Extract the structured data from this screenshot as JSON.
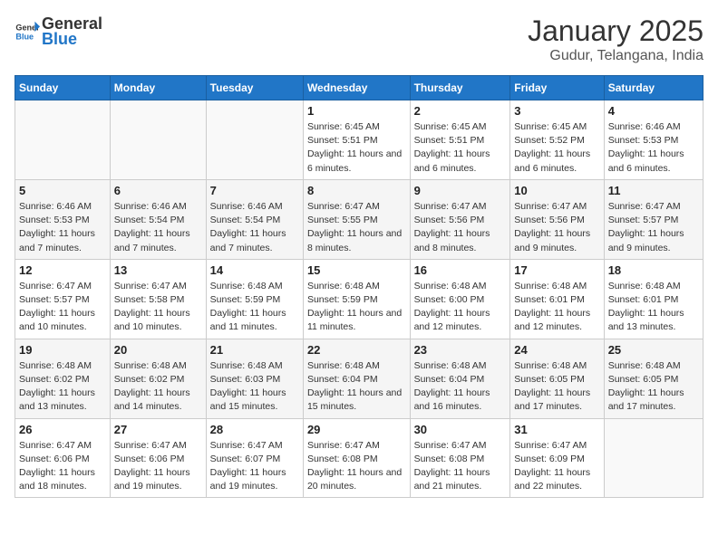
{
  "header": {
    "logo_general": "General",
    "logo_blue": "Blue",
    "title": "January 2025",
    "subtitle": "Gudur, Telangana, India"
  },
  "weekdays": [
    "Sunday",
    "Monday",
    "Tuesday",
    "Wednesday",
    "Thursday",
    "Friday",
    "Saturday"
  ],
  "weeks": [
    [
      {
        "day": "",
        "sunrise": "",
        "sunset": "",
        "daylight": ""
      },
      {
        "day": "",
        "sunrise": "",
        "sunset": "",
        "daylight": ""
      },
      {
        "day": "",
        "sunrise": "",
        "sunset": "",
        "daylight": ""
      },
      {
        "day": "1",
        "sunrise": "Sunrise: 6:45 AM",
        "sunset": "Sunset: 5:51 PM",
        "daylight": "Daylight: 11 hours and 6 minutes."
      },
      {
        "day": "2",
        "sunrise": "Sunrise: 6:45 AM",
        "sunset": "Sunset: 5:51 PM",
        "daylight": "Daylight: 11 hours and 6 minutes."
      },
      {
        "day": "3",
        "sunrise": "Sunrise: 6:45 AM",
        "sunset": "Sunset: 5:52 PM",
        "daylight": "Daylight: 11 hours and 6 minutes."
      },
      {
        "day": "4",
        "sunrise": "Sunrise: 6:46 AM",
        "sunset": "Sunset: 5:53 PM",
        "daylight": "Daylight: 11 hours and 6 minutes."
      }
    ],
    [
      {
        "day": "5",
        "sunrise": "Sunrise: 6:46 AM",
        "sunset": "Sunset: 5:53 PM",
        "daylight": "Daylight: 11 hours and 7 minutes."
      },
      {
        "day": "6",
        "sunrise": "Sunrise: 6:46 AM",
        "sunset": "Sunset: 5:54 PM",
        "daylight": "Daylight: 11 hours and 7 minutes."
      },
      {
        "day": "7",
        "sunrise": "Sunrise: 6:46 AM",
        "sunset": "Sunset: 5:54 PM",
        "daylight": "Daylight: 11 hours and 7 minutes."
      },
      {
        "day": "8",
        "sunrise": "Sunrise: 6:47 AM",
        "sunset": "Sunset: 5:55 PM",
        "daylight": "Daylight: 11 hours and 8 minutes."
      },
      {
        "day": "9",
        "sunrise": "Sunrise: 6:47 AM",
        "sunset": "Sunset: 5:56 PM",
        "daylight": "Daylight: 11 hours and 8 minutes."
      },
      {
        "day": "10",
        "sunrise": "Sunrise: 6:47 AM",
        "sunset": "Sunset: 5:56 PM",
        "daylight": "Daylight: 11 hours and 9 minutes."
      },
      {
        "day": "11",
        "sunrise": "Sunrise: 6:47 AM",
        "sunset": "Sunset: 5:57 PM",
        "daylight": "Daylight: 11 hours and 9 minutes."
      }
    ],
    [
      {
        "day": "12",
        "sunrise": "Sunrise: 6:47 AM",
        "sunset": "Sunset: 5:57 PM",
        "daylight": "Daylight: 11 hours and 10 minutes."
      },
      {
        "day": "13",
        "sunrise": "Sunrise: 6:47 AM",
        "sunset": "Sunset: 5:58 PM",
        "daylight": "Daylight: 11 hours and 10 minutes."
      },
      {
        "day": "14",
        "sunrise": "Sunrise: 6:48 AM",
        "sunset": "Sunset: 5:59 PM",
        "daylight": "Daylight: 11 hours and 11 minutes."
      },
      {
        "day": "15",
        "sunrise": "Sunrise: 6:48 AM",
        "sunset": "Sunset: 5:59 PM",
        "daylight": "Daylight: 11 hours and 11 minutes."
      },
      {
        "day": "16",
        "sunrise": "Sunrise: 6:48 AM",
        "sunset": "Sunset: 6:00 PM",
        "daylight": "Daylight: 11 hours and 12 minutes."
      },
      {
        "day": "17",
        "sunrise": "Sunrise: 6:48 AM",
        "sunset": "Sunset: 6:01 PM",
        "daylight": "Daylight: 11 hours and 12 minutes."
      },
      {
        "day": "18",
        "sunrise": "Sunrise: 6:48 AM",
        "sunset": "Sunset: 6:01 PM",
        "daylight": "Daylight: 11 hours and 13 minutes."
      }
    ],
    [
      {
        "day": "19",
        "sunrise": "Sunrise: 6:48 AM",
        "sunset": "Sunset: 6:02 PM",
        "daylight": "Daylight: 11 hours and 13 minutes."
      },
      {
        "day": "20",
        "sunrise": "Sunrise: 6:48 AM",
        "sunset": "Sunset: 6:02 PM",
        "daylight": "Daylight: 11 hours and 14 minutes."
      },
      {
        "day": "21",
        "sunrise": "Sunrise: 6:48 AM",
        "sunset": "Sunset: 6:03 PM",
        "daylight": "Daylight: 11 hours and 15 minutes."
      },
      {
        "day": "22",
        "sunrise": "Sunrise: 6:48 AM",
        "sunset": "Sunset: 6:04 PM",
        "daylight": "Daylight: 11 hours and 15 minutes."
      },
      {
        "day": "23",
        "sunrise": "Sunrise: 6:48 AM",
        "sunset": "Sunset: 6:04 PM",
        "daylight": "Daylight: 11 hours and 16 minutes."
      },
      {
        "day": "24",
        "sunrise": "Sunrise: 6:48 AM",
        "sunset": "Sunset: 6:05 PM",
        "daylight": "Daylight: 11 hours and 17 minutes."
      },
      {
        "day": "25",
        "sunrise": "Sunrise: 6:48 AM",
        "sunset": "Sunset: 6:05 PM",
        "daylight": "Daylight: 11 hours and 17 minutes."
      }
    ],
    [
      {
        "day": "26",
        "sunrise": "Sunrise: 6:47 AM",
        "sunset": "Sunset: 6:06 PM",
        "daylight": "Daylight: 11 hours and 18 minutes."
      },
      {
        "day": "27",
        "sunrise": "Sunrise: 6:47 AM",
        "sunset": "Sunset: 6:06 PM",
        "daylight": "Daylight: 11 hours and 19 minutes."
      },
      {
        "day": "28",
        "sunrise": "Sunrise: 6:47 AM",
        "sunset": "Sunset: 6:07 PM",
        "daylight": "Daylight: 11 hours and 19 minutes."
      },
      {
        "day": "29",
        "sunrise": "Sunrise: 6:47 AM",
        "sunset": "Sunset: 6:08 PM",
        "daylight": "Daylight: 11 hours and 20 minutes."
      },
      {
        "day": "30",
        "sunrise": "Sunrise: 6:47 AM",
        "sunset": "Sunset: 6:08 PM",
        "daylight": "Daylight: 11 hours and 21 minutes."
      },
      {
        "day": "31",
        "sunrise": "Sunrise: 6:47 AM",
        "sunset": "Sunset: 6:09 PM",
        "daylight": "Daylight: 11 hours and 22 minutes."
      },
      {
        "day": "",
        "sunrise": "",
        "sunset": "",
        "daylight": ""
      }
    ]
  ]
}
